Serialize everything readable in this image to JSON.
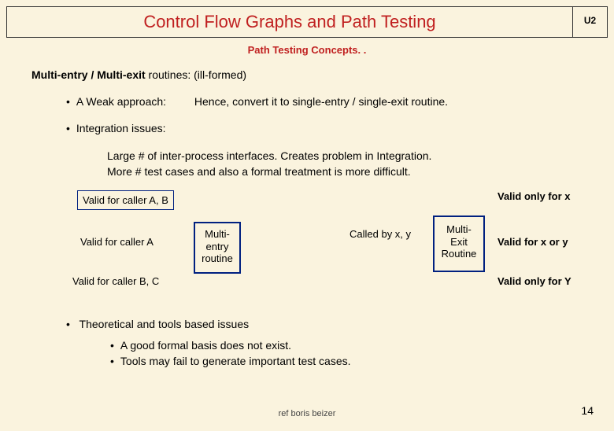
{
  "header": {
    "title": "Control Flow Graphs and Path Testing",
    "unit": "U2"
  },
  "subtitle": "Path Testing Concepts. .",
  "heading": {
    "bold": "Multi-entry / Multi-exit",
    "rest": " routines:  (ill-formed)"
  },
  "weak": {
    "label": "A Weak approach:",
    "text": "Hence, convert it to single-entry / single-exit routine."
  },
  "integration": {
    "label": "Integration issues:",
    "line1": "Large # of inter-process interfaces. Creates problem in Integration.",
    "line2": "More # test cases and also a formal treatment is more difficult."
  },
  "diagram": {
    "valid_ab": "Valid for caller A, B",
    "valid_a": "Valid for caller A",
    "valid_bc": "Valid for caller B, C",
    "multi_entry": "Multi-entry routine",
    "called_xy": "Called by x, y",
    "multi_exit": "Multi-Exit Routine",
    "valid_only_x": "Valid only for x",
    "valid_x_or_y": "Valid for x or y",
    "valid_only_y": "Valid only for Y"
  },
  "lower": {
    "theoretical": "Theoretical and tools based issues",
    "sub1": "A good formal basis does not exist.",
    "sub2": "Tools may fail to generate important test cases."
  },
  "footer_overlap": "ref boris beizer",
  "page_number": "14"
}
